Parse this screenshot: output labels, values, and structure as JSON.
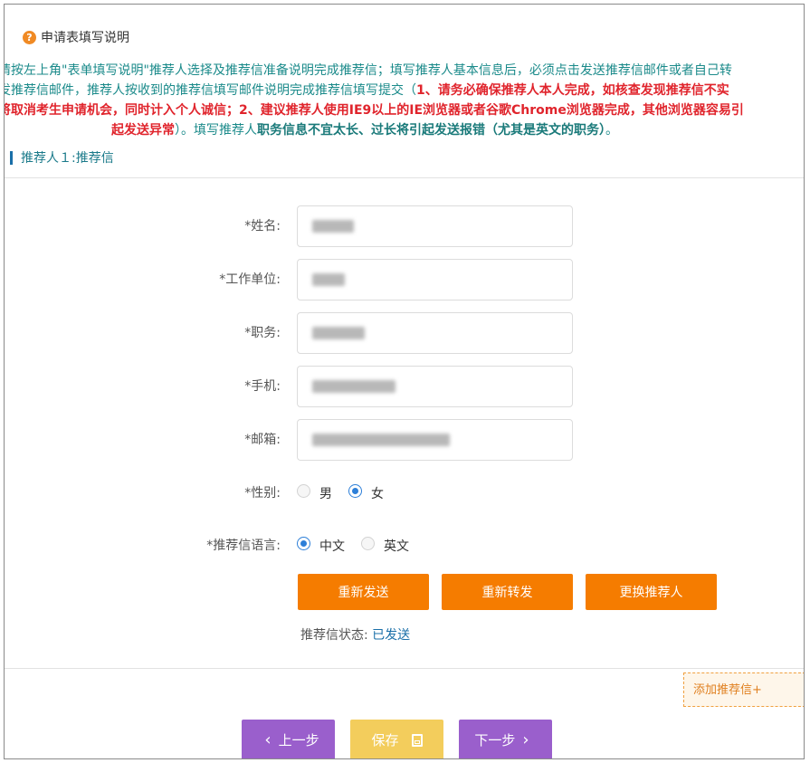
{
  "help": {
    "icon": "question-icon",
    "label": "申请表填写说明"
  },
  "notice": {
    "line1": "请按左上角\"表单填写说明\"推荐人选择及推荐信准备说明完成推荐信；填写推荐人基本信息后，必须点击发送推荐信邮件或者自己转",
    "line2_a": "发推荐信邮件，推荐人按收到的推荐信填写邮件说明完成推荐信填写提交（",
    "line2_b": "1、请务必确保推荐人本人完成，如核查发现推荐信不实",
    "line3_a": "将取消考生申请机会，同时计入个人诚信；2、建议推荐人使用IE9以上的IE浏览器或者谷歌Chrome浏览器完成，其他浏览器容易引",
    "line4_a": "起发送异常",
    "line4_b": "）。填写推荐人",
    "line4_c": "职务信息不宜太长、过长将引起发送报错（尤其是英文的职务）",
    "line4_d": "。"
  },
  "section": {
    "title": "推荐人１:推荐信"
  },
  "form": {
    "name_label": "*姓名:",
    "org_label": "*工作单位:",
    "position_label": "*职务:",
    "phone_label": "*手机:",
    "email_label": "*邮箱:",
    "gender_label": "*性别:",
    "gender_options": [
      "男",
      "女"
    ],
    "gender_selected": "女",
    "lang_label": "*推荐信语言:",
    "lang_options": [
      "中文",
      "英文"
    ],
    "lang_selected": "中文"
  },
  "buttons": {
    "resend": "重新发送",
    "forward": "重新转发",
    "replace": "更换推荐人"
  },
  "status": {
    "label": "推荐信状态:",
    "value": "已发送"
  },
  "add_letter": "添加推荐信+",
  "nav": {
    "prev": "上一步",
    "save": "保存",
    "next": "下一步"
  },
  "colors": {
    "accent_orange": "#f57c00",
    "nav_purple": "#9a5fcc",
    "save_yellow": "#f3cd5c",
    "notice_teal": "#1a8a8a",
    "warning_red": "#e0242c"
  }
}
